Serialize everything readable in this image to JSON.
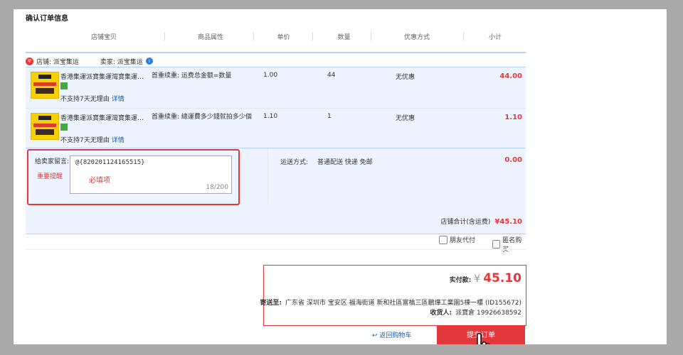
{
  "page_title": "确认订单信息",
  "columns": [
    "店铺宝贝",
    "商品属性",
    "单价",
    "数量",
    "优惠方式",
    "小计"
  ],
  "shop": {
    "shop_label": "店铺: 派宝集运",
    "seller_label": "卖家: 派宝集运"
  },
  "items": [
    {
      "title": "香港集運派寶集運灣寶集運可達...",
      "prop": "首重续重: 运费总金额=数量",
      "price": "1.00",
      "qty": "44",
      "discount": "无优惠",
      "subtotal": "44.00",
      "no_return": "不支持7天无理由",
      "detail": "详情"
    },
    {
      "title": "香港集運派寶集運灣寶集運可達...",
      "prop": "首重续重: 總運費多少錢就拍多少個",
      "price": "1.10",
      "qty": "1",
      "discount": "无优惠",
      "subtotal": "1.10",
      "no_return": "不支持7天无理由",
      "detail": "详情"
    }
  ],
  "message": {
    "label": "给卖家留言:",
    "important": "重要提醒",
    "value": "@{820201124165515}",
    "required_note": "必填项",
    "counter": "18/200"
  },
  "shipping": {
    "label": "运送方式:",
    "value": "普通配送 快递 免邮",
    "price": "0.00"
  },
  "store_total": {
    "label": "店铺合计(含运费)",
    "value": "¥45.10"
  },
  "options": {
    "friend_pay": "朋友代付",
    "anonymous": "匿名购买"
  },
  "summary": {
    "pay_label": "实付款:",
    "currency": "¥",
    "amount": "45.10",
    "address_label": "寄送至:",
    "address": "广东省 深圳市 宝安区 福海街道 新和社區富橋三區鵬燁工業園5棟一樓 (ID155672)",
    "receiver_label": "收货人:",
    "receiver": "派寶倉 19926638592"
  },
  "actions": {
    "back": "返回购物车",
    "submit": "提交订单"
  }
}
